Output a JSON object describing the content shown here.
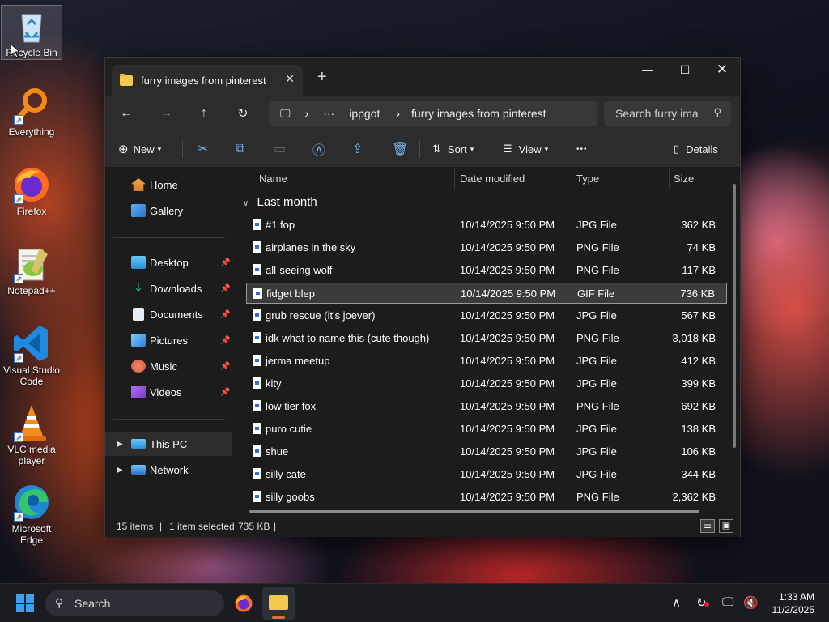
{
  "desktop": {
    "icons": [
      {
        "label": "Recycle Bin",
        "icon": "recycle-bin-icon"
      },
      {
        "label": "Everything",
        "icon": "everything-search-icon"
      },
      {
        "label": "Firefox",
        "icon": "firefox-icon"
      },
      {
        "label": "Notepad++",
        "icon": "notepad-plus-plus-icon"
      },
      {
        "label": "Visual Studio Code",
        "icon": "vscode-icon"
      },
      {
        "label": "VLC media player",
        "icon": "vlc-icon"
      },
      {
        "label": "Microsoft Edge",
        "icon": "edge-icon"
      }
    ]
  },
  "window": {
    "tab_title": "furry images from pinterest",
    "new_tab": "+",
    "breadcrumb": {
      "more": "···",
      "parent": "ippgot",
      "current": "furry images from pinterest",
      "sep": "›"
    },
    "search_placeholder": "Search furry ima",
    "commands": {
      "new": "New",
      "sort": "Sort",
      "view": "View",
      "more": "•••",
      "details": "Details"
    },
    "sidebar": {
      "home": "Home",
      "gallery": "Gallery",
      "desktop": "Desktop",
      "downloads": "Downloads",
      "documents": "Documents",
      "pictures": "Pictures",
      "music": "Music",
      "videos": "Videos",
      "this_pc": "This PC",
      "network": "Network"
    },
    "columns": {
      "name": "Name",
      "date": "Date modified",
      "type": "Type",
      "size": "Size"
    },
    "group_label": "Last month",
    "files": [
      {
        "name": "#1 fop",
        "date": "10/14/2025 9:50 PM",
        "type": "JPG File",
        "size": "362 KB"
      },
      {
        "name": "airplanes in the sky",
        "date": "10/14/2025 9:50 PM",
        "type": "PNG File",
        "size": "74 KB"
      },
      {
        "name": "all-seeing wolf",
        "date": "10/14/2025 9:50 PM",
        "type": "PNG File",
        "size": "117 KB"
      },
      {
        "name": "fidget blep",
        "date": "10/14/2025 9:50 PM",
        "type": "GIF File",
        "size": "736 KB",
        "selected": true
      },
      {
        "name": "grub rescue (it's joever)",
        "date": "10/14/2025 9:50 PM",
        "type": "JPG File",
        "size": "567 KB"
      },
      {
        "name": "idk what to name this (cute though)",
        "date": "10/14/2025 9:50 PM",
        "type": "PNG File",
        "size": "3,018 KB"
      },
      {
        "name": "jerma meetup",
        "date": "10/14/2025 9:50 PM",
        "type": "JPG File",
        "size": "412 KB"
      },
      {
        "name": "kity",
        "date": "10/14/2025 9:50 PM",
        "type": "JPG File",
        "size": "399 KB"
      },
      {
        "name": "low tier fox",
        "date": "10/14/2025 9:50 PM",
        "type": "PNG File",
        "size": "692 KB"
      },
      {
        "name": "puro cutie",
        "date": "10/14/2025 9:50 PM",
        "type": "JPG File",
        "size": "138 KB"
      },
      {
        "name": "shue",
        "date": "10/14/2025 9:50 PM",
        "type": "JPG File",
        "size": "106 KB"
      },
      {
        "name": "silly cate",
        "date": "10/14/2025 9:50 PM",
        "type": "JPG File",
        "size": "344 KB"
      },
      {
        "name": "silly goobs",
        "date": "10/14/2025 9:50 PM",
        "type": "PNG File",
        "size": "2,362 KB"
      }
    ],
    "status": {
      "count": "15 items",
      "selected": "1 item selected",
      "size": "735 KB"
    }
  },
  "taskbar": {
    "search": "Search",
    "time": "1:33 AM",
    "date": "11/2/2025"
  }
}
